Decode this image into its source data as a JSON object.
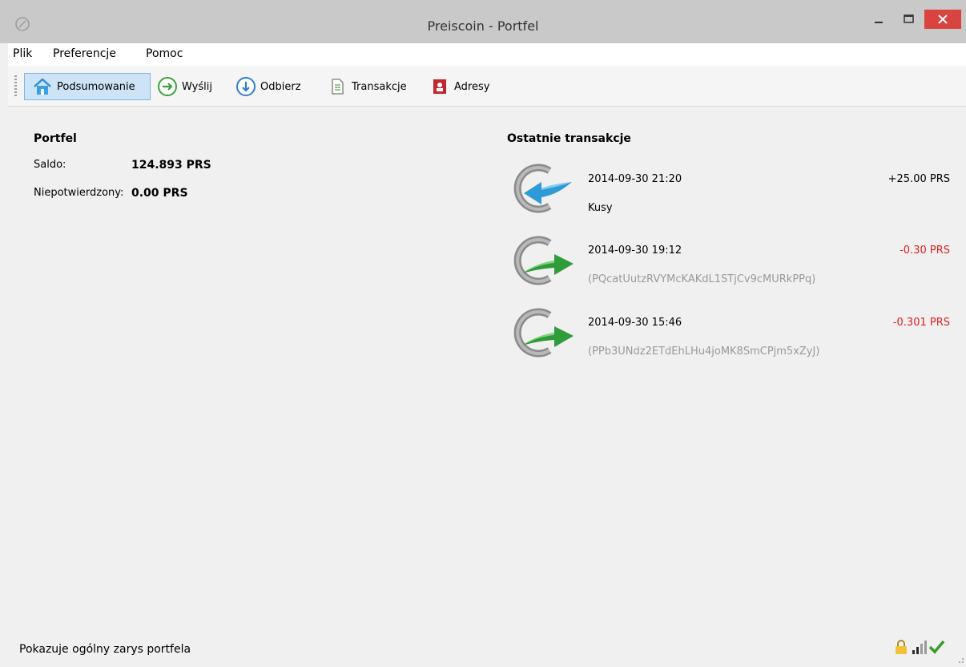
{
  "window": {
    "title": "Preiscoin - Portfel"
  },
  "menu": {
    "items": [
      "Plik",
      "Preferencje",
      "Pomoc"
    ]
  },
  "toolbar": {
    "buttons": [
      {
        "label": "Podsumowanie",
        "icon": "home-icon",
        "active": true
      },
      {
        "label": "Wyślij",
        "icon": "send-arrow-icon"
      },
      {
        "label": "Odbierz",
        "icon": "receive-arrow-icon"
      },
      {
        "label": "Transakcje",
        "icon": "document-icon"
      },
      {
        "label": "Adresy",
        "icon": "address-book-icon"
      }
    ]
  },
  "wallet": {
    "title": "Portfel",
    "balance_label": "Saldo:",
    "balance_value": "124.893 PRS",
    "unconfirmed_label": "Niepotwierdzony:",
    "unconfirmed_value": "0.00 PRS"
  },
  "recent": {
    "title": "Ostatnie transakcje",
    "transactions": [
      {
        "date": "2014-09-30 21:20",
        "label": "Kusy",
        "amount": "+25.00 PRS",
        "type": "received"
      },
      {
        "date": "2014-09-30 19:12",
        "label": "(PQcatUutzRVYMcKAKdL1STjCv9cMURkPPq)",
        "amount": "-0.30 PRS",
        "type": "sent"
      },
      {
        "date": "2014-09-30 15:46",
        "label": "(PPb3UNdz2ETdEhLHu4joMK8SmCPjm5xZyJ)",
        "amount": "-0.301 PRS",
        "type": "sent"
      }
    ]
  },
  "status": {
    "text": "Pokazuje ogólny zarys portfela",
    "icons": [
      "lock-icon",
      "signal-icon",
      "sync-check-icon"
    ]
  },
  "colors": {
    "negative": "#e0201b",
    "positive": "#000000",
    "address": "#999999",
    "active_bg": "#cde4f7",
    "close_btn": "#d9443f"
  }
}
